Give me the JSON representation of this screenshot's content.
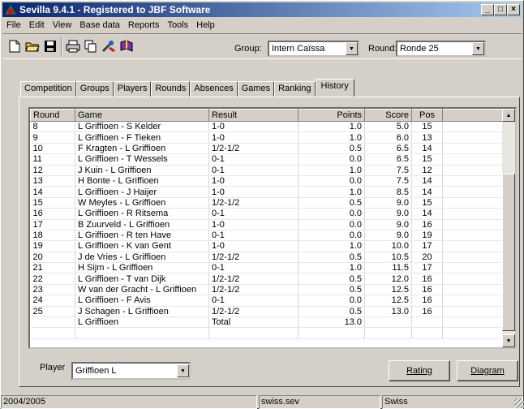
{
  "window": {
    "title": "Sevilla 9.4.1 - Registered to JBF Software"
  },
  "menu": [
    "File",
    "Edit",
    "View",
    "Base data",
    "Reports",
    "Tools",
    "Help"
  ],
  "toolbar": {
    "group_label": "Group:",
    "group_value": "Intern Caïssa",
    "round_label": "Round:",
    "round_value": "Ronde 25"
  },
  "tabs": [
    "Competition",
    "Groups",
    "Players",
    "Rounds",
    "Absences",
    "Games",
    "Ranking",
    "History"
  ],
  "active_tab": "History",
  "table": {
    "headers": [
      "Round",
      "Game",
      "Result",
      "Points",
      "Score",
      "Pos"
    ],
    "rows": [
      [
        "8",
        "L Griffioen - S Kelder",
        "1-0",
        "1.0",
        "5.0",
        "15"
      ],
      [
        "9",
        "L Griffioen - F Tieken",
        "1-0",
        "1.0",
        "6.0",
        "13"
      ],
      [
        "10",
        "F Kragten - L Griffioen",
        "1/2-1/2",
        "0.5",
        "6.5",
        "14"
      ],
      [
        "11",
        "L Griffioen - T Wessels",
        "0-1",
        "0.0",
        "6.5",
        "15"
      ],
      [
        "12",
        "J Kuin - L Griffioen",
        "0-1",
        "1.0",
        "7.5",
        "12"
      ],
      [
        "13",
        "H Bonte - L Griffioen",
        "1-0",
        "0.0",
        "7.5",
        "14"
      ],
      [
        "14",
        "L Griffioen - J Haijer",
        "1-0",
        "1.0",
        "8.5",
        "14"
      ],
      [
        "15",
        "W Meyles - L Griffioen",
        "1/2-1/2",
        "0.5",
        "9.0",
        "15"
      ],
      [
        "16",
        "L Griffioen - R Ritsema",
        "0-1",
        "0.0",
        "9.0",
        "14"
      ],
      [
        "17",
        "B Zuurveld - L Griffioen",
        "1-0",
        "0.0",
        "9.0",
        "16"
      ],
      [
        "18",
        "L Griffioen - R ten Have",
        "0-1",
        "0.0",
        "9.0",
        "19"
      ],
      [
        "19",
        "L Griffioen - K van Gent",
        "1-0",
        "1.0",
        "10.0",
        "17"
      ],
      [
        "20",
        "J de Vries - L Griffioen",
        "1/2-1/2",
        "0.5",
        "10.5",
        "20"
      ],
      [
        "21",
        "H Sijm - L Griffioen",
        "0-1",
        "1.0",
        "11.5",
        "17"
      ],
      [
        "22",
        "L Griffioen - T van Dijk",
        "1/2-1/2",
        "0.5",
        "12.0",
        "16"
      ],
      [
        "23",
        "W van der Gracht - L Griffioen",
        "1/2-1/2",
        "0.5",
        "12.5",
        "16"
      ],
      [
        "24",
        "L Griffioen - F Avis",
        "0-1",
        "0.0",
        "12.5",
        "16"
      ],
      [
        "25",
        "J Schagen - L Griffioen",
        "1/2-1/2",
        "0.5",
        "13.0",
        "16"
      ],
      [
        "",
        "L Griffioen",
        "Total",
        "13.0",
        "",
        ""
      ],
      [
        "",
        "",
        "",
        "",
        "",
        ""
      ]
    ]
  },
  "player": {
    "label": "Player",
    "value": "Griffioen L"
  },
  "buttons": {
    "rating": "Rating",
    "diagram": "Diagram"
  },
  "status": {
    "season": "2004/2005",
    "file": "swiss.sev",
    "system": "Swiss"
  }
}
